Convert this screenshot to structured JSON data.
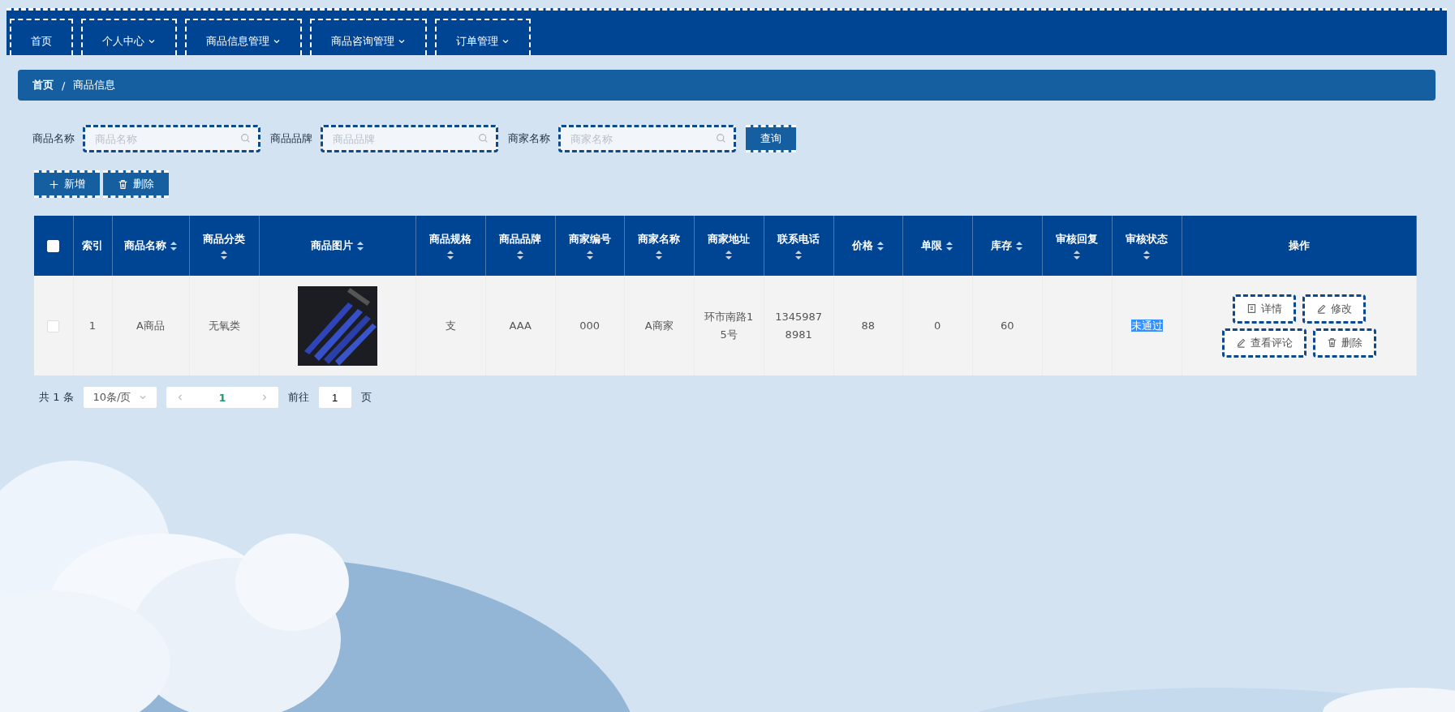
{
  "nav": {
    "items": [
      {
        "label": "首页",
        "dropdown": false
      },
      {
        "label": "个人中心",
        "dropdown": true
      },
      {
        "label": "商品信息管理",
        "dropdown": true
      },
      {
        "label": "商品咨询管理",
        "dropdown": true
      },
      {
        "label": "订单管理",
        "dropdown": true
      }
    ]
  },
  "breadcrumb": {
    "items": [
      "首页",
      "商品信息"
    ],
    "separator": "/"
  },
  "search": {
    "fields": [
      {
        "label": "商品名称",
        "placeholder": "商品名称"
      },
      {
        "label": "商品品牌",
        "placeholder": "商品品牌"
      },
      {
        "label": "商家名称",
        "placeholder": "商家名称"
      }
    ],
    "button": "查询"
  },
  "actions": [
    {
      "label": "新增",
      "kind": "add"
    },
    {
      "label": "删除",
      "kind": "delete"
    }
  ],
  "table": {
    "columns": [
      {
        "kind": "checkbox",
        "checked": false
      },
      {
        "kind": "text",
        "label": "索引",
        "sortable": false
      },
      {
        "kind": "text",
        "label": "商品名称",
        "sortable": true
      },
      {
        "kind": "text",
        "label": "商品分类",
        "sortable": true
      },
      {
        "label": "商品图片",
        "sortable": true
      },
      {
        "kind": "text",
        "label": "商品规格",
        "sortable": true
      },
      {
        "kind": "text",
        "label": "商品品牌",
        "sortable": true
      },
      {
        "kind": "text",
        "label": "商家编号",
        "sortable": true
      },
      {
        "kind": "text",
        "label": "商家名称",
        "sortable": true
      },
      {
        "kind": "text",
        "label": "商家地址",
        "sortable": true
      },
      {
        "kind": "text",
        "label": "联系电话",
        "sortable": true
      },
      {
        "kind": "text",
        "label": "价格",
        "sortable": true
      },
      {
        "kind": "text",
        "label": "单限",
        "sortable": true
      },
      {
        "kind": "text",
        "label": "库存",
        "sortable": true
      },
      {
        "kind": "text",
        "label": "审核回复",
        "sortable": true
      },
      {
        "kind": "status",
        "label": "审核状态",
        "sortable": true
      },
      {
        "kind": "actions",
        "label": "操作",
        "sortable": false
      }
    ],
    "rows": [
      {
        "checked": false,
        "cells": [
          "",
          "1",
          "A商品",
          "无氧类",
          "",
          "支",
          "AAA",
          "000",
          "A商家",
          "环市南路15号",
          "13459878981",
          "88",
          "0",
          "60",
          "",
          "未通过",
          ""
        ],
        "actions": [
          {
            "label": "详情",
            "kind": "detail"
          },
          {
            "label": "修改",
            "kind": "edit"
          },
          {
            "label": "查看评论",
            "kind": "comments"
          },
          {
            "label": "删除",
            "kind": "delete"
          }
        ]
      }
    ]
  },
  "pagination": {
    "total": "共 1 条",
    "page_size": "10条/页",
    "pages": [
      {
        "label": "1",
        "selected": true
      }
    ],
    "goto": "前往",
    "goto_value": "1",
    "page_unit": "页"
  }
}
